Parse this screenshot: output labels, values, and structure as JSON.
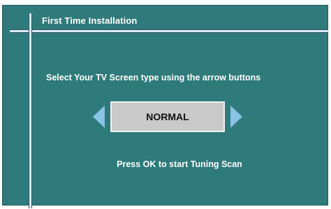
{
  "window": {
    "title": "First Time Installation"
  },
  "main": {
    "prompt": "Select Your TV Screen type using the arrow buttons",
    "selector": {
      "value": "NORMAL",
      "left_icon": "arrow-left-icon",
      "right_icon": "arrow-right-icon"
    },
    "hint": "Press OK to start Tuning Scan"
  },
  "colors": {
    "panel_background": "#2f7b7b",
    "frame_line": "#d8ecf7",
    "arrow": "#8ac3e6",
    "value_box": "#c9c9c9",
    "text": "#ffffff"
  }
}
